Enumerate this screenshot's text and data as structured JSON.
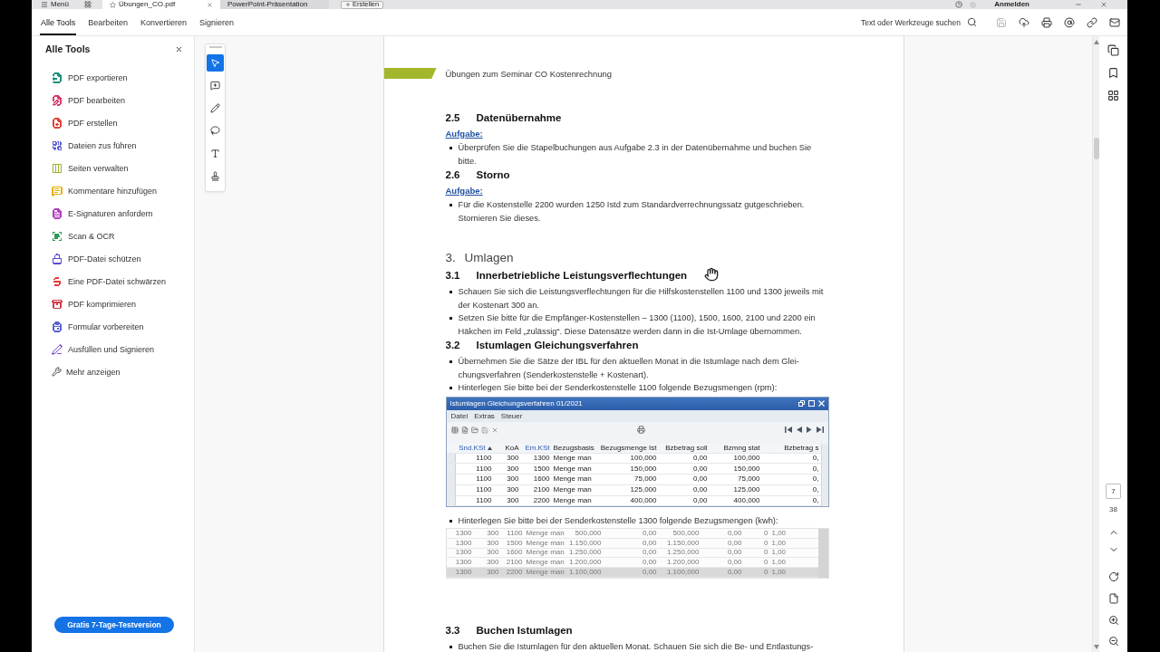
{
  "title_bar": {
    "menu_label": "Menü",
    "tabs": [
      {
        "label": "Übungen_CO.pdf",
        "selected": true,
        "starred": true
      },
      {
        "label": "PowerPoint-Präsentation",
        "selected": false,
        "starred": false
      }
    ],
    "create_label": "Erstellen",
    "sign_in_label": "Anmelden"
  },
  "menu_bar": {
    "tabs": [
      {
        "label": "Alle Tools",
        "selected": true
      },
      {
        "label": "Bearbeiten",
        "selected": false
      },
      {
        "label": "Konvertieren",
        "selected": false
      },
      {
        "label": "Signieren",
        "selected": false
      }
    ],
    "search_label": "Text oder Werkzeuge suchen",
    "actions": [
      {
        "disabled": true
      },
      {
        "disabled": false
      },
      {
        "disabled": false
      },
      {
        "disabled": false
      },
      {
        "disabled": false
      },
      {
        "disabled": false
      }
    ]
  },
  "sidebar": {
    "title": "Alle Tools",
    "items": [
      {
        "label": "PDF exportieren",
        "color": "#1d8f77"
      },
      {
        "label": "PDF bearbeiten",
        "color": "#d83b6a"
      },
      {
        "label": "PDF erstellen",
        "color": "#e0443a"
      },
      {
        "label": "Dateien zus führen",
        "color": "#5a5fd6"
      },
      {
        "label": "Seiten verwalten",
        "color": "#a3b23a"
      },
      {
        "label": "Kommentare hinzufügen",
        "color": "#e8b10c"
      },
      {
        "label": "E-Signaturen anfordern",
        "color": "#b43fbf"
      },
      {
        "label": "Scan & OCR",
        "color": "#2e9a57"
      },
      {
        "label": "PDF-Datei schützen",
        "color": "#5b4dd3"
      },
      {
        "label": "Eine PDF-Datei schwärzen",
        "color": "#e03a3a"
      },
      {
        "label": "PDF komprimieren",
        "color": "#d63a4a"
      },
      {
        "label": "Formular vorbereiten",
        "color": "#5b5fd8"
      },
      {
        "label": "Ausfüllen und Signieren",
        "color": "#7b52d4"
      }
    ],
    "more_label": "Mehr anzeigen",
    "trial_button": "Gratis 7-Tage-Testversion"
  },
  "tools": [
    {
      "selected": true
    },
    {
      "selected": false
    },
    {
      "selected": false
    },
    {
      "selected": false
    },
    {
      "selected": false
    },
    {
      "selected": false
    }
  ],
  "document": {
    "header": "Übungen zum Seminar CO Kostenrechnung",
    "blocks": [
      {
        "kind": "heading",
        "number": "2.5",
        "text": "Datenübernahme"
      },
      {
        "kind": "label",
        "text": "Aufgabe:"
      },
      {
        "kind": "bullets",
        "items": [
          "Überprüfen Sie die Stapelbuchungen aus Aufgabe 2.3 in der Datenübernahme und buchen Sie bitte."
        ]
      },
      {
        "kind": "heading",
        "number": "2.6",
        "text": "Storno"
      },
      {
        "kind": "label",
        "text": "Aufgabe:"
      },
      {
        "kind": "bullets",
        "items": [
          "Für die Kostenstelle 2200 wurden 1250 Istd zum Standardverrechnungssatz gutgeschrieben. Stornieren Sie dieses."
        ]
      },
      {
        "kind": "chapter",
        "number": "3.",
        "text": "Umlagen"
      },
      {
        "kind": "heading",
        "number": "3.1",
        "text": "Innerbetriebliche Leistungsverflechtungen"
      },
      {
        "kind": "bullets",
        "items": [
          "Schauen Sie sich die Leistungsverflechtungen für die Hilfskostenstellen 1100 und 1300 jeweils mit der Kostenart 300 an.",
          "Setzen Sie bitte für die Empfänger-Kostenstellen – 1300 (1100), 1500, 1600, 2100 und 2200 ein Häkchen im Feld „zulässig“. Diese Datensätze werden dann in die Ist-Umlage übernommen."
        ]
      },
      {
        "kind": "heading",
        "number": "3.2",
        "text": "Istumlagen Gleichungsverfahren"
      },
      {
        "kind": "bullets",
        "items": [
          "Übernehmen Sie die Sätze der IBL für den aktuellen Monat in die Istumlage nach dem Glei-chungsverfahren (Senderkostenstelle + Kostenart).",
          "Hinterlegen Sie bitte bei der Senderkostenstelle 1100 folgende Bezugsmengen (rpm):"
        ]
      },
      {
        "kind": "sap_window",
        "title": "Istumlagen Gleichungsverfahren 01/2021",
        "menu": [
          "Datei",
          "Extras",
          "Steuer"
        ],
        "columns": [
          {
            "label": "Snd.KSt",
            "key": true,
            "sorted": true
          },
          {
            "label": "KoA",
            "key": false,
            "sorted": false
          },
          {
            "label": "Em.KSt",
            "key": true,
            "sorted": false
          },
          {
            "label": "Bezugsbasis",
            "key": false,
            "sorted": false
          },
          {
            "label": "Bezugsmenge Ist",
            "key": false,
            "sorted": false
          },
          {
            "label": "Bzbetrag soll",
            "key": false,
            "sorted": false
          },
          {
            "label": "Bzmng stat",
            "key": false,
            "sorted": false
          },
          {
            "label": "Bzbetrag s",
            "key": false,
            "sorted": false
          }
        ],
        "rows": [
          [
            "1100",
            "300",
            "1300",
            "Menge man",
            "100,000",
            "0,00",
            "100,000",
            "0,"
          ],
          [
            "1100",
            "300",
            "1500",
            "Menge man",
            "150,000",
            "0,00",
            "150,000",
            "0,"
          ],
          [
            "1100",
            "300",
            "1600",
            "Menge man",
            "75,000",
            "0,00",
            "75,000",
            "0,"
          ],
          [
            "1100",
            "300",
            "2100",
            "Menge man",
            "125,000",
            "0,00",
            "125,000",
            "0,"
          ],
          [
            "1100",
            "300",
            "2200",
            "Menge man",
            "400,000",
            "0,00",
            "400,000",
            "0,"
          ]
        ]
      },
      {
        "kind": "bullets",
        "items": [
          "Hinterlegen Sie bitte bei der Senderkostenstelle 1300 folgende Bezugsmengen (kwh):"
        ]
      },
      {
        "kind": "image_table",
        "rows": [
          {
            "cells": [
              "1300",
              "300",
              "1100",
              "Menge man",
              "500,000",
              "0,00",
              "500,000",
              "0,00",
              "0",
              "1,00"
            ],
            "selected": false
          },
          {
            "cells": [
              "1300",
              "300",
              "1500",
              "Menge man",
              "1.150,000",
              "0,00",
              "1.150,000",
              "0,00",
              "0",
              "1,00"
            ],
            "selected": false
          },
          {
            "cells": [
              "1300",
              "300",
              "1600",
              "Menge man",
              "1.250,000",
              "0,00",
              "1.250,000",
              "0,00",
              "0",
              "1,00"
            ],
            "selected": false
          },
          {
            "cells": [
              "1300",
              "300",
              "2100",
              "Menge man",
              "1.200,000",
              "0,00",
              "1.200,000",
              "0,00",
              "0",
              "1,00"
            ],
            "selected": false
          },
          {
            "cells": [
              "1300",
              "300",
              "2200",
              "Menge man",
              "1.100,000",
              "0,00",
              "1.100,000",
              "0,00",
              "0",
              "1,00"
            ],
            "selected": true
          }
        ]
      },
      {
        "kind": "heading",
        "number": "3.3",
        "text": "Buchen Istumlagen"
      },
      {
        "kind": "bullets",
        "items": [
          "Buchen Sie die Istumlagen für den aktuellen Monat. Schauen Sie sich die Be- und Entlastungs-"
        ]
      }
    ]
  },
  "page_nav": {
    "current": "7",
    "total": "38"
  }
}
